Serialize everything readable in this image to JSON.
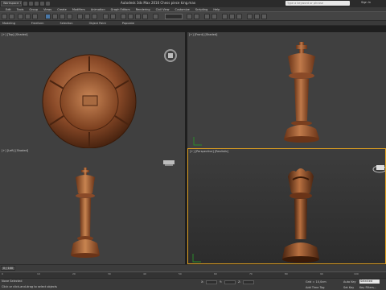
{
  "window": {
    "workspace": "Workspace: Default",
    "title": "Autodesk 3ds Max 2016    Chess piece king.max",
    "search_placeholder": "Type a keyword or phrase",
    "sign_in": "Sign In"
  },
  "menu": [
    "Edit",
    "Tools",
    "Group",
    "Views",
    "Create",
    "Modifiers",
    "Animation",
    "Graph Editors",
    "Rendering",
    "Civil View",
    "Customize",
    "Scripting",
    "Help"
  ],
  "ribbon": [
    "Modeling",
    "Freeform",
    "Selection",
    "Object Paint",
    "Populate"
  ],
  "viewports": {
    "top": "[+] [Top] [Shaded]",
    "front": "[+] [Front] [Shaded]",
    "left": "[+] [Left] [Shaded]",
    "perspective": "[+] [Perspective] [Realistic]"
  },
  "timeline": {
    "frame_counter": "0 / 100",
    "ticks": [
      "0",
      "10",
      "20",
      "30",
      "40",
      "50",
      "60",
      "70",
      "80",
      "90",
      "100"
    ]
  },
  "status": {
    "selection": "None Selected",
    "prompt": "Click or click-and-drag to select objects",
    "x_label": "X:",
    "y_label": "Y:",
    "z_label": "Z:",
    "grid": "Grid = 10,0cm",
    "add_time_tag": "Add Time Tag",
    "auto_key": "Auto Key",
    "set_key": "Set Key",
    "key_filters": "Key Filters...",
    "selected": "Selected"
  },
  "colors": {
    "wood": "#8a4a28",
    "wood_light": "#c07a4a",
    "viewport_active_border": "#e0a020"
  }
}
